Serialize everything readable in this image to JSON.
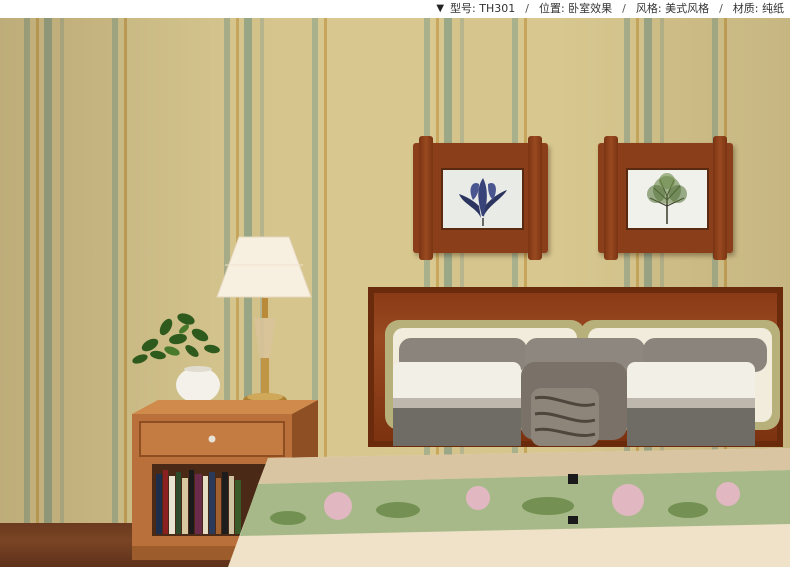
{
  "spec_bar": {
    "marker": "▼",
    "model_label": "型号: TH301",
    "sep1": "/",
    "location_label": "位置: 卧室效果",
    "sep2": "/",
    "style_label": "风格: 美式风格",
    "sep3": "/",
    "material_label": "材质: 纯纸"
  },
  "colors": {
    "wall_base": "#d8c890",
    "stripe_green": "#a9b08c",
    "stripe_gold": "#c9a85e",
    "wood": "#8a3e1a",
    "floor": "#6b3a1f"
  },
  "scene_objects": {
    "frame_left_art": "blue-flower-print",
    "frame_right_art": "tree-print",
    "lamp": "table-lamp",
    "plant": "potted-plant",
    "nightstand": "wooden-nightstand",
    "bed": "bed-with-pillows"
  }
}
